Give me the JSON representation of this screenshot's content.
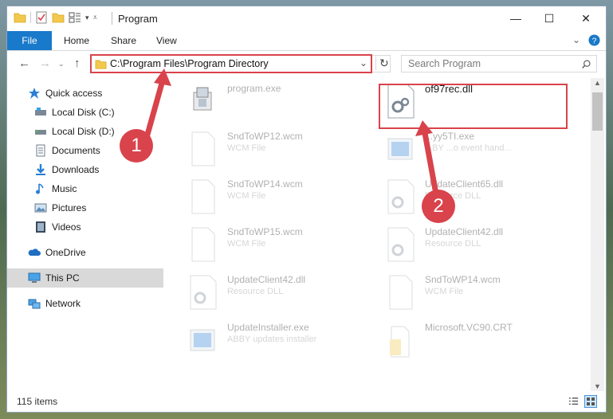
{
  "window": {
    "title": "Program",
    "minimize_glyph": "—",
    "maximize_glyph": "☐",
    "close_glyph": "✕"
  },
  "ribbon": {
    "tabs": [
      "File",
      "Home",
      "Share",
      "View"
    ]
  },
  "navigation": {
    "address": "C:\\Program Files\\Program Directory",
    "search_placeholder": "Search Program"
  },
  "sidebar": {
    "items": [
      {
        "label": "Quick access",
        "icon": "star-icon"
      },
      {
        "label": "Local Disk (C:)",
        "icon": "drive-icon",
        "pinned": true
      },
      {
        "label": "Local Disk (D:)",
        "icon": "drive-icon",
        "pinned": true
      },
      {
        "label": "Documents",
        "icon": "documents-icon",
        "pinned": true
      },
      {
        "label": "Downloads",
        "icon": "download-icon",
        "pinned": true
      },
      {
        "label": "Music",
        "icon": "music-icon",
        "pinned": true
      },
      {
        "label": "Pictures",
        "icon": "pictures-icon",
        "pinned": true
      },
      {
        "label": "Videos",
        "icon": "videos-icon",
        "pinned": true
      },
      {
        "label": "OneDrive",
        "icon": "cloud-icon"
      },
      {
        "label": "This PC",
        "icon": "computer-icon"
      },
      {
        "label": "Network",
        "icon": "network-icon"
      }
    ]
  },
  "files": [
    {
      "name": "program.exe",
      "sub": ""
    },
    {
      "name": "of97rec.dll",
      "sub": ""
    },
    {
      "name": "SndToWP12.wcm",
      "sub": "WCM File"
    },
    {
      "name": "...yy5TI.exe",
      "sub": "...BY ...o event hand..."
    },
    {
      "name": "SndToWP14.wcm",
      "sub": "WCM File"
    },
    {
      "name": "UpdateClient65.dll",
      "sub": "Resource DLL"
    },
    {
      "name": "SndToWP15.wcm",
      "sub": "WCM File"
    },
    {
      "name": "UpdateClient42.dll",
      "sub": "Resource DLL"
    },
    {
      "name": "UpdateClient42.dll",
      "sub": "Resource DLL"
    },
    {
      "name": "SndToWP14.wcm",
      "sub": "WCM File"
    },
    {
      "name": "UpdateInstaller.exe",
      "sub": "ABBY updates installer"
    },
    {
      "name": "Microsoft.VC90.CRT",
      "sub": ""
    }
  ],
  "status": {
    "item_count": "115 items"
  },
  "callouts": [
    "1",
    "2"
  ],
  "colors": {
    "accent": "#1979ca",
    "highlight": "#d9434b"
  }
}
